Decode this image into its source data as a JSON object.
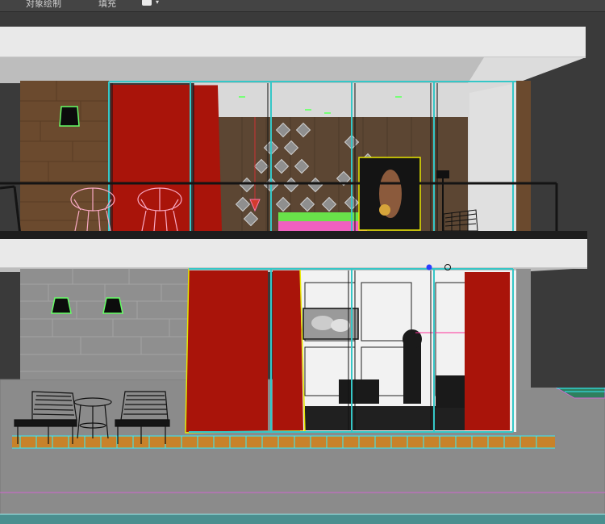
{
  "app": {
    "menu": [
      {
        "label": "对象绘制",
        "name": "menu-object-paint"
      },
      {
        "label": "填充",
        "name": "menu-populate"
      }
    ],
    "extra_icon": "viewport-display-icon"
  },
  "viewport": {
    "label": "3d-perspective-viewport",
    "scene": "two-storey-house-facade",
    "colors": {
      "background": "#3a3a3a",
      "ground": "#8c8c8c",
      "slab": "#e9e9e9",
      "wood": "#6b4a2e",
      "curtain": "#a9140a",
      "glass_frame": "#35c7c7",
      "selection_yellow": "#e6e600",
      "selection_magenta": "#ff40ff",
      "deck": "#c8822a",
      "railing": "#141414"
    }
  }
}
